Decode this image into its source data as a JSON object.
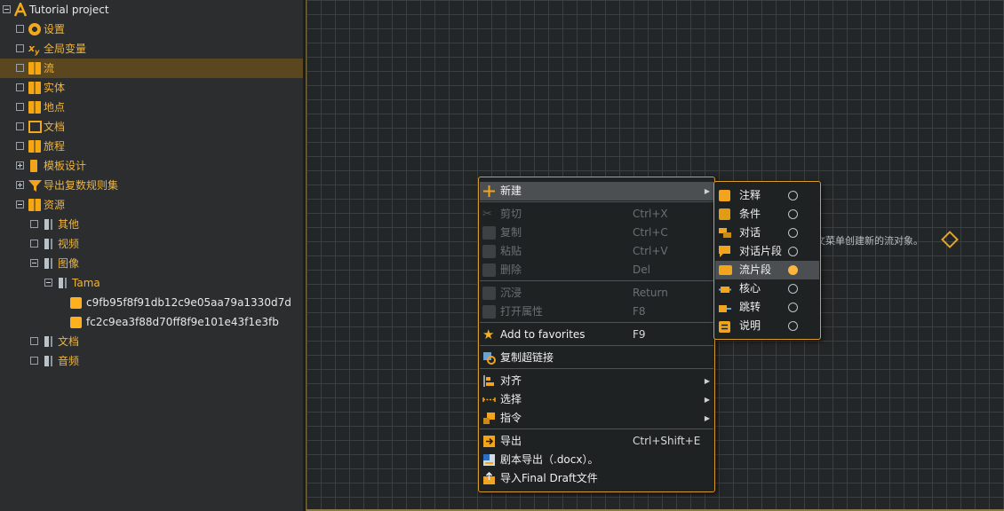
{
  "tree": {
    "root_label": "Tutorial project",
    "items": [
      {
        "label": "设置",
        "icon": "gear-icon"
      },
      {
        "label": "全局变量",
        "icon": "variable-icon"
      },
      {
        "label": "流",
        "icon": "flow-icon"
      },
      {
        "label": "实体",
        "icon": "entity-icon"
      },
      {
        "label": "地点",
        "icon": "location-icon"
      },
      {
        "label": "文档",
        "icon": "document-icon"
      },
      {
        "label": "旅程",
        "icon": "journey-icon"
      },
      {
        "label": "模板设计",
        "icon": "template-icon"
      },
      {
        "label": "导出复数规则集",
        "icon": "filter-icon"
      },
      {
        "label": "资源",
        "icon": "assets-icon"
      },
      {
        "label": "其他",
        "icon": "folder-icon"
      },
      {
        "label": "视频",
        "icon": "folder-icon"
      },
      {
        "label": "图像",
        "icon": "folder-icon"
      },
      {
        "label": "Tama",
        "icon": "folder-icon"
      },
      {
        "label": "c9fb95f8f91db12c9e05aa79a1330d7d",
        "icon": "image-icon"
      },
      {
        "label": "fc2c9ea3f88d70ff8f9e101e43f1e3fb",
        "icon": "image-icon"
      },
      {
        "label": "文档",
        "icon": "folder-icon"
      },
      {
        "label": "音频",
        "icon": "folder-icon"
      }
    ]
  },
  "canvas": {
    "hint_text": "文菜单创建新的流对象。"
  },
  "context_menu": {
    "new": "新建",
    "cut": {
      "label": "剪切",
      "key": "Ctrl+X"
    },
    "copy": {
      "label": "复制",
      "key": "Ctrl+C"
    },
    "paste": {
      "label": "粘贴",
      "key": "Ctrl+V"
    },
    "delete": {
      "label": "删除",
      "key": "Del"
    },
    "dive": {
      "label": "沉浸",
      "key": "Return"
    },
    "properties": {
      "label": "打开属性",
      "key": "F8"
    },
    "favorites": {
      "label": "Add to favorites",
      "key": "F9"
    },
    "copy_link": "复制超链接",
    "align": "对齐",
    "select": "选择",
    "command": "指令",
    "export": {
      "label": "导出",
      "key": "Ctrl+Shift+E"
    },
    "script_export": "剧本导出（.docx）。",
    "import_fd": "导入Final Draft文件"
  },
  "submenu": {
    "items": [
      {
        "label": "注释"
      },
      {
        "label": "条件"
      },
      {
        "label": "对话"
      },
      {
        "label": "对话片段"
      },
      {
        "label": "流片段"
      },
      {
        "label": "核心"
      },
      {
        "label": "跳转"
      },
      {
        "label": "说明"
      }
    ],
    "selected": "流片段"
  },
  "colors": {
    "accent": "#f0b43a",
    "selection": "#5a4720",
    "menu_highlight": "#4b4f52"
  }
}
